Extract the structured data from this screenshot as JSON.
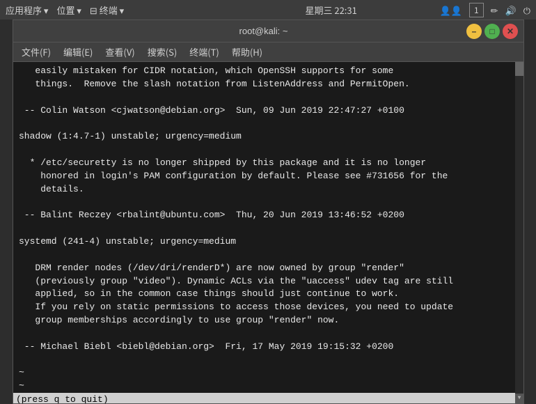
{
  "systemBar": {
    "apps": "应用程序",
    "places": "位置",
    "terminal": "终端",
    "datetime": "星期三 22:31",
    "workspaceNum": "1"
  },
  "titleBar": {
    "title": "root@kali: ~",
    "minimizeLabel": "–",
    "maximizeLabel": "□",
    "closeLabel": "✕"
  },
  "menuBar": {
    "file": "文件(F)",
    "edit": "编辑(E)",
    "view": "查看(V)",
    "search": "搜索(S)",
    "terminal": "终端(T)",
    "help": "帮助(H)"
  },
  "terminalContent": {
    "lines": [
      "   easily mistaken for CIDR notation, which OpenSSH supports for some",
      "   things.  Remove the slash notation from ListenAddress and PermitOpen.",
      "",
      " -- Colin Watson <cjwatson@debian.org>  Sun, 09 Jun 2019 22:47:27 +0100",
      "",
      "shadow (1:4.7-1) unstable; urgency=medium",
      "",
      "  * /etc/securetty is no longer shipped by this package and it is no longer",
      "    honored in login's PAM configuration by default. Please see #731656 for the",
      "    details.",
      "",
      " -- Balint Reczey <rbalint@ubuntu.com>  Thu, 20 Jun 2019 13:46:52 +0200",
      "",
      "systemd (241-4) unstable; urgency=medium",
      "",
      "   DRM render nodes (/dev/dri/renderD*) are now owned by group \"render\"",
      "   (previously group \"video\"). Dynamic ACLs via the \"uaccess\" udev tag are still",
      "   applied, so in the common case things should just continue to work.",
      "   If you rely on static permissions to access those devices, you need to update",
      "   group memberships accordingly to use group \"render\" now.",
      "",
      " -- Michael Biebl <biebl@debian.org>  Fri, 17 May 2019 19:15:32 +0200",
      "",
      "~",
      "~"
    ],
    "statusLine": "(press q to quit)"
  }
}
